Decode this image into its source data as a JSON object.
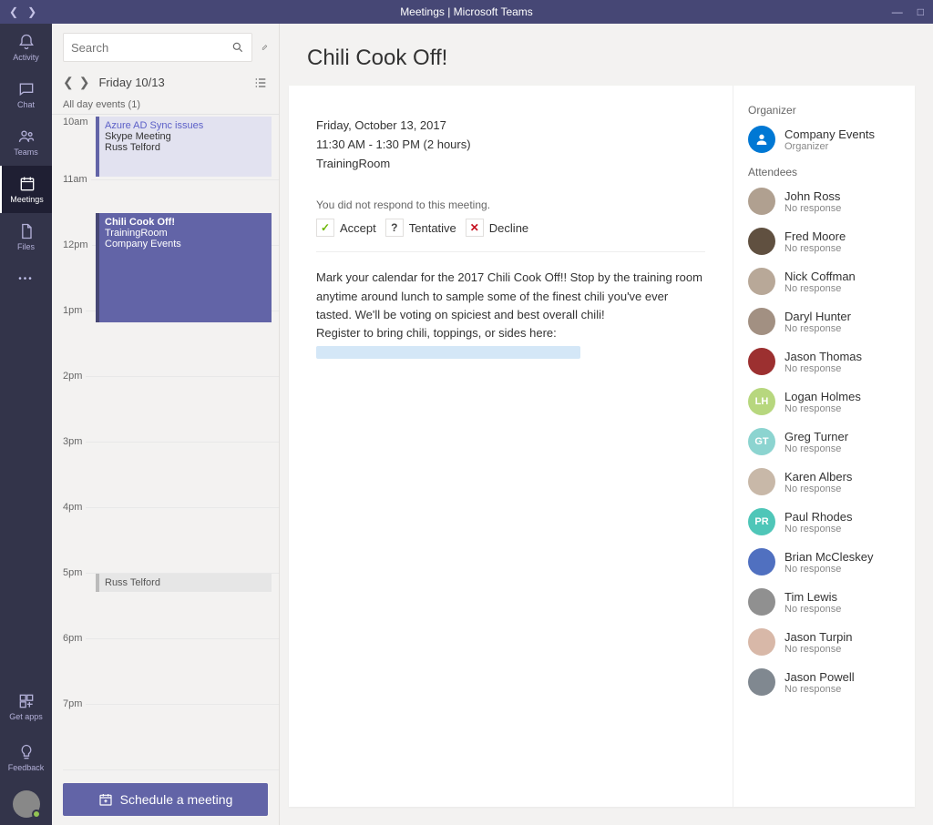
{
  "window": {
    "title": "Meetings | Microsoft Teams"
  },
  "rail": {
    "activity": "Activity",
    "chat": "Chat",
    "teams": "Teams",
    "meetings": "Meetings",
    "files": "Files",
    "getapps": "Get apps",
    "feedback": "Feedback"
  },
  "mid": {
    "search_placeholder": "Search",
    "date_label": "Friday 10/13",
    "all_day_label": "All day events (1)",
    "hours": [
      "10am",
      "11am",
      "12pm",
      "1pm",
      "2pm",
      "3pm",
      "4pm",
      "5pm",
      "6pm",
      "7pm"
    ],
    "evt_azure": {
      "title": "Azure AD Sync issues",
      "sub1": "Skype Meeting",
      "sub2": "Russ Telford"
    },
    "evt_chili": {
      "title": "Chili Cook Off!",
      "sub1": "TrainingRoom",
      "sub2": "Company Events"
    },
    "evt_priv": {
      "sub": "Russ Telford"
    },
    "schedule_label": "Schedule a meeting"
  },
  "main": {
    "title": "Chili Cook Off!",
    "date": "Friday, October 13, 2017",
    "time": "11:30 AM - 1:30 PM (2 hours)",
    "loc": "TrainingRoom",
    "resp_line": "You did not respond to this meeting.",
    "accept": "Accept",
    "tentative": "Tentative",
    "decline": "Decline",
    "desc_l1": "Mark your calendar for the 2017 Chili Cook Off!! Stop by the training room anytime around lunch to sample some of the finest chili you've ever tasted. We'll be voting on spiciest and best overall chili!",
    "desc_l2": "Register to bring chili, toppings, or sides here:"
  },
  "right": {
    "organizer_label": "Organizer",
    "attendees_label": "Attendees",
    "organizer": {
      "name": "Company Events",
      "status": "Organizer",
      "color": "#0078d4",
      "initials": "person"
    },
    "attendees": [
      {
        "name": "John Ross",
        "status": "No response",
        "color": "#b0a090"
      },
      {
        "name": "Fred Moore",
        "status": "No response",
        "color": "#605040"
      },
      {
        "name": "Nick Coffman",
        "status": "No response",
        "color": "#b8a898"
      },
      {
        "name": "Daryl Hunter",
        "status": "No response",
        "color": "#a29082"
      },
      {
        "name": "Jason Thomas",
        "status": "No response",
        "color": "#9c3030"
      },
      {
        "name": "Logan Holmes",
        "status": "No response",
        "color": "#b7d77e",
        "initials": "LH"
      },
      {
        "name": "Greg Turner",
        "status": "No response",
        "color": "#8cd4d0",
        "initials": "GT"
      },
      {
        "name": "Karen Albers",
        "status": "No response",
        "color": "#c8b8a8"
      },
      {
        "name": "Paul Rhodes",
        "status": "No response",
        "color": "#4fc6b8",
        "initials": "PR"
      },
      {
        "name": "Brian McCleskey",
        "status": "No response",
        "color": "#5070c0"
      },
      {
        "name": "Tim Lewis",
        "status": "No response",
        "color": "#909090"
      },
      {
        "name": "Jason Turpin",
        "status": "No response",
        "color": "#d8b8a8"
      },
      {
        "name": "Jason Powell",
        "status": "No response",
        "color": "#808890"
      }
    ]
  }
}
